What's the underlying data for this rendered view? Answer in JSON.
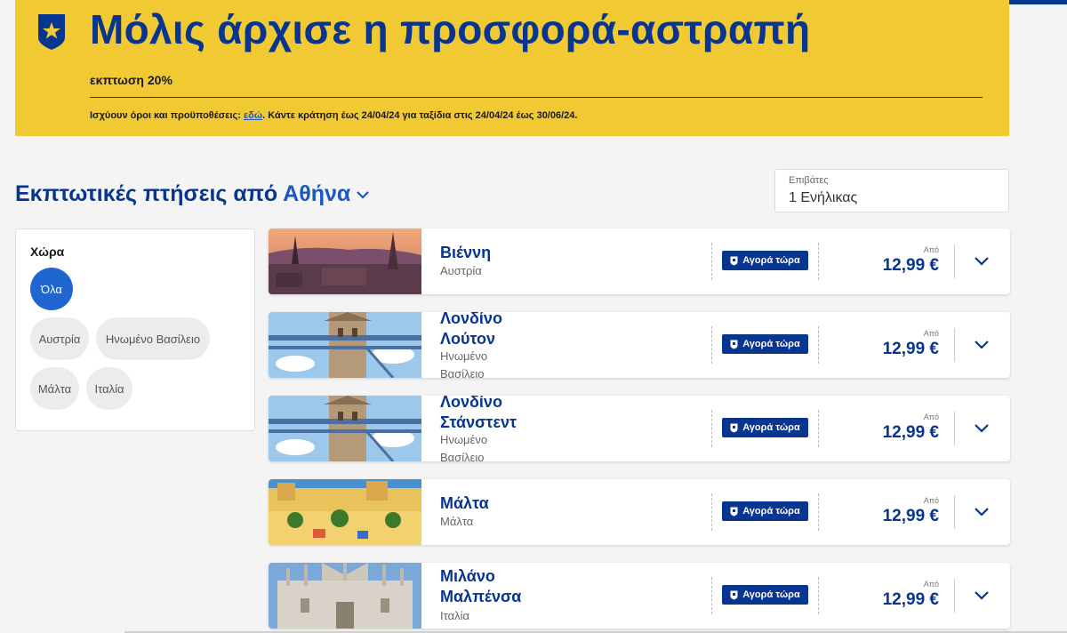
{
  "promo": {
    "title": "Μόλις άρχισε η προσφορά-αστραπή",
    "subtitle": "εκπτωση 20%",
    "terms_prefix": "Ισχύουν όροι και προϋποθέσεις: ",
    "terms_link": "εδώ",
    "terms_suffix": ". Κάντε κράτηση έως 24/04/24 για ταξίδια στις 24/04/24 έως 30/06/24."
  },
  "heading": {
    "prefix": "Εκπτωτικές πτήσεις από ",
    "city": "Αθήνα"
  },
  "passengers": {
    "label": "Επιβάτες",
    "value": "1 Ενήλικας"
  },
  "filter": {
    "header": "Χώρα",
    "chips": [
      "Όλα",
      "Αυστρία",
      "Ηνωμένο Βασίλειο",
      "Μάλτα",
      "Ιταλία"
    ],
    "selected": "Όλα"
  },
  "flights": [
    {
      "name": "Βιέννη",
      "country": "Αυστρία",
      "buy": "Αγορά τώρα",
      "from": "Από",
      "price": "12,99 €"
    },
    {
      "name": "Λονδίνο Λούτον",
      "country": "Ηνωμένο Βασίλειο",
      "buy": "Αγορά τώρα",
      "from": "Από",
      "price": "12,99 €"
    },
    {
      "name": "Λονδίνο Στάνστεντ",
      "country": "Ηνωμένο Βασίλειο",
      "buy": "Αγορά τώρα",
      "from": "Από",
      "price": "12,99 €"
    },
    {
      "name": "Μάλτα",
      "country": "Μάλτα",
      "buy": "Αγορά τώρα",
      "from": "Από",
      "price": "12,99 €"
    },
    {
      "name": "Μιλάνο Μαλπένσα",
      "country": "Ιταλία",
      "buy": "Αγορά τώρα",
      "from": "Από",
      "price": "12,99 €"
    }
  ],
  "colors": {
    "brand_blue": "#073590",
    "promo_yellow": "#f1c933",
    "link_blue": "#1a56c4",
    "chip_active": "#1f66d1"
  }
}
